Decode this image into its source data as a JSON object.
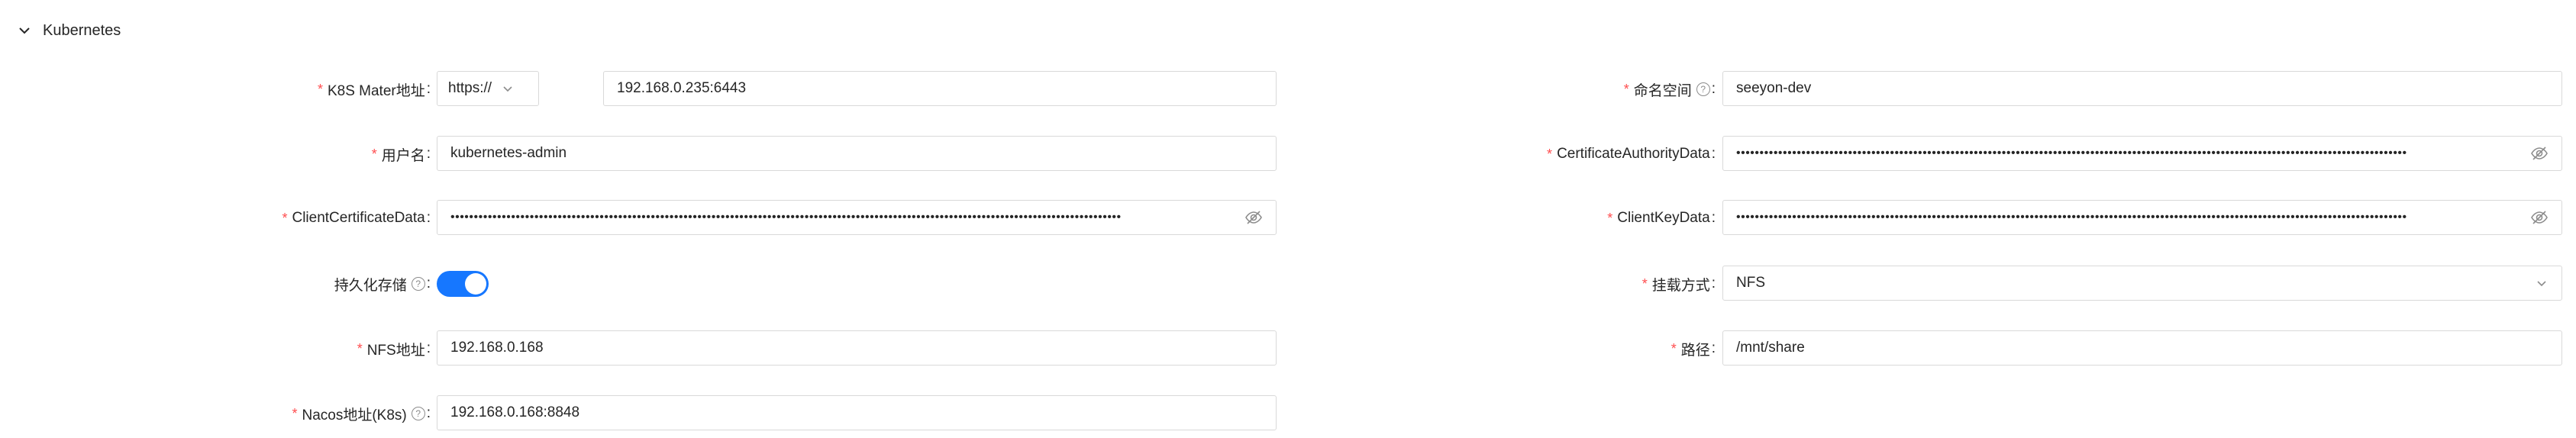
{
  "section": {
    "title": "Kubernetes",
    "icon": "chevron-down-icon"
  },
  "left": {
    "master": {
      "label": "K8S Mater地址",
      "required": "*",
      "protocol": "https://",
      "value": "192.168.0.235:6443"
    },
    "username": {
      "label": "用户名",
      "required": "*",
      "value": "kubernetes-admin"
    },
    "client_cert": {
      "label": "ClientCertificateData",
      "required": "*",
      "masked": "••••••••••••••••••••••••••••••••••••••••••••••••••••••••••••••••••••••••••••••••••••••••••••••••••••••••••••••••••••••••••••••••••••••••••••••••"
    },
    "persistence": {
      "label": "持久化存储",
      "help": "?",
      "enabled": true
    },
    "nfs": {
      "label": "NFS地址",
      "required": "*",
      "value": "192.168.0.168"
    },
    "nacos": {
      "label": "Nacos地址(K8s)",
      "required": "*",
      "help": "?",
      "value": "192.168.0.168:8848"
    }
  },
  "right": {
    "namespace": {
      "label": "命名空间",
      "required": "*",
      "help": "?",
      "value": "seeyon-dev"
    },
    "ca_data": {
      "label": "CertificateAuthorityData",
      "required": "*",
      "masked": "••••••••••••••••••••••••••••••••••••••••••••••••••••••••••••••••••••••••••••••••••••••••••••••••••••••••••••••••••••••••••••••••••••••••••••••••"
    },
    "client_key": {
      "label": "ClientKeyData",
      "required": "*",
      "masked": "••••••••••••••••••••••••••••••••••••••••••••••••••••••••••••••••••••••••••••••••••••••••••••••••••••••••••••••••••••••••••••••••••••••••••••••••"
    },
    "mount": {
      "label": "挂载方式",
      "required": "*",
      "value": "NFS"
    },
    "path": {
      "label": "路径",
      "required": "*",
      "value": "/mnt/share"
    }
  },
  "colors": {
    "accent": "#1677ff",
    "required": "#ff4d4f",
    "border": "#d9d9d9"
  }
}
